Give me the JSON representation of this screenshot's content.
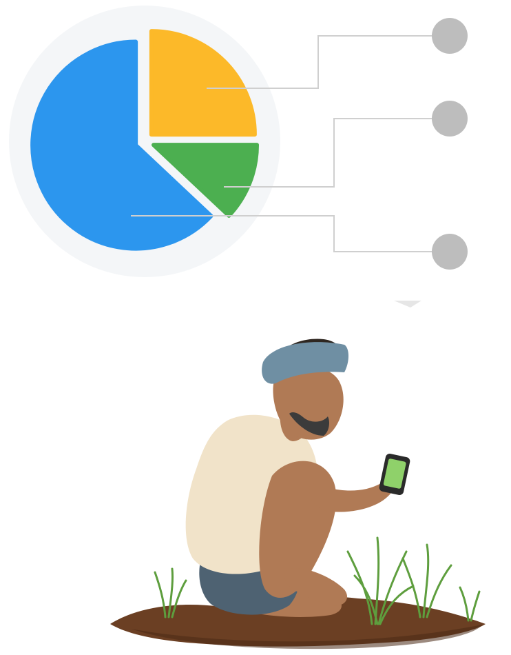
{
  "chart_data": {
    "type": "pie",
    "title": "",
    "slices": [
      {
        "name": "",
        "value": 25,
        "color": "#FCB929"
      },
      {
        "name": "",
        "value": 12,
        "color": "#4CAF50"
      },
      {
        "name": "",
        "value": 63,
        "color": "#2C96EE"
      }
    ],
    "exploded": true,
    "legend": "right",
    "legend_marker_color": "#BDBDBD",
    "leader_line_color": "#CFCFCF",
    "background_disc_color": "#F4F6F8"
  },
  "illustration": {
    "subject": "farmer-with-phone",
    "colors": {
      "turban": "#6F8FA3",
      "skin": "#B07A55",
      "vest": "#F1E3C9",
      "shorts": "#4E6272",
      "soil": "#6B3F23",
      "grass": "#5E9E3E",
      "phone": "#2A2A2A",
      "screen": "#8FD16A"
    }
  }
}
